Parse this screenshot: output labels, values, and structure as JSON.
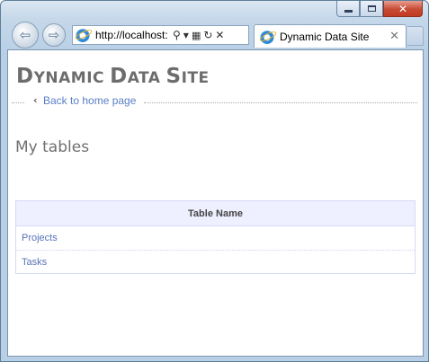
{
  "browser": {
    "address_url": "http://localhost:",
    "tab_title": "Dynamic Data Site",
    "icons": [
      "back-arrow-icon",
      "forward-arrow-icon",
      "ie-logo-icon",
      "search-icon",
      "dropdown-icon",
      "compatibility-icon",
      "refresh-icon",
      "stop-icon",
      "close-icon",
      "minimize-icon",
      "maximize-icon"
    ]
  },
  "page": {
    "site_title_first_letter_1": "D",
    "site_title_rest_1": "YNAMIC",
    "site_title_first_letter_2": "D",
    "site_title_rest_2": "ATA",
    "site_title_first_letter_3": "S",
    "site_title_rest_3": "ITE",
    "back_link": "Back to home page",
    "tables_heading": "My tables",
    "grid": {
      "header": "Table Name",
      "rows": [
        "Projects",
        "Tasks"
      ]
    }
  },
  "colors": {
    "title": "#6d6d6d",
    "link": "#5a7fc7",
    "grid_header_bg": "#eeefff",
    "grid_border": "#d6daf5"
  }
}
